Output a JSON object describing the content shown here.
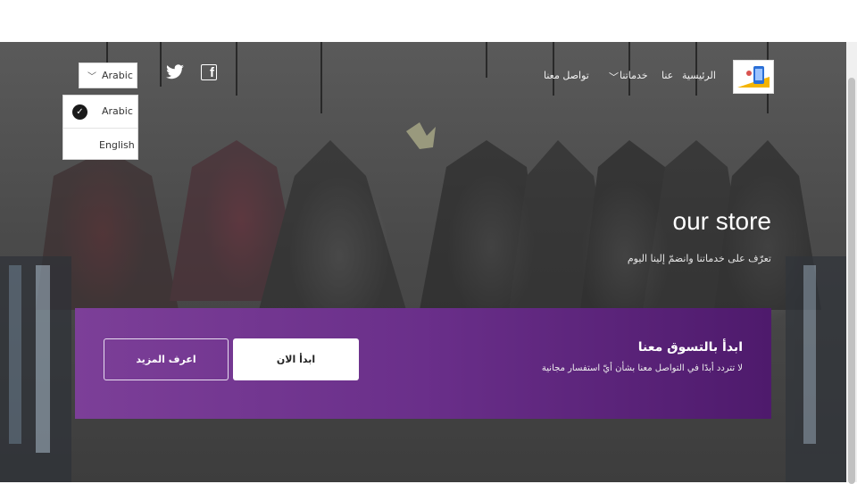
{
  "colors": {
    "cta_start": "#7c3f98",
    "cta_end": "#4e1a6c",
    "nav_text": "#f2f2f2"
  },
  "nav": {
    "home": "الرئيسية",
    "about": "عنا",
    "services": "خدماتنا",
    "contact": "تواصل معنا"
  },
  "language": {
    "selected": "Arabic",
    "options": [
      {
        "label": "Arabic",
        "checked": true
      },
      {
        "label": "English",
        "checked": false
      }
    ]
  },
  "social": {
    "twitter": "twitter-icon",
    "facebook": "facebook-icon"
  },
  "hero": {
    "title": "our store",
    "subtitle": "تعرّف على خدماتنا وانضمّ إلينا اليوم"
  },
  "cta": {
    "title": "ابدأ بالتسوق معنا",
    "description": "لا تتردد أبدًا في التواصل معنا بشأن أيّ استفسار مجانية",
    "start_button": "ابدأ الان",
    "more_button": "اعرف المزيد"
  }
}
